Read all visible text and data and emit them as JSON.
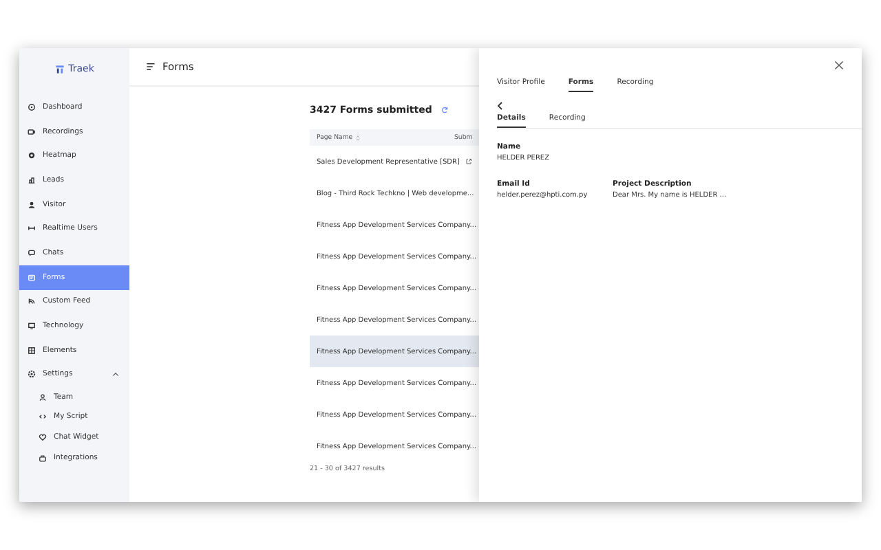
{
  "sidebar": {
    "logo": "Traek",
    "items": [
      {
        "label": "Dashboard",
        "selected": false
      },
      {
        "label": "Recordings",
        "selected": false
      },
      {
        "label": "Heatmap",
        "selected": false
      },
      {
        "label": "Leads",
        "selected": false
      },
      {
        "label": "Visitor",
        "selected": false
      },
      {
        "label": "Realtime Users",
        "selected": false
      },
      {
        "label": "Chats",
        "selected": false
      },
      {
        "label": "Forms",
        "selected": true
      },
      {
        "label": "Custom Feed",
        "selected": false
      },
      {
        "label": "Technology",
        "selected": false
      },
      {
        "label": "Elements",
        "selected": false
      },
      {
        "label": "Settings",
        "selected": false,
        "expanded": true,
        "children": [
          {
            "label": "Team",
            "selected": false
          },
          {
            "label": "My Script",
            "selected": false
          },
          {
            "label": "Chat Widget",
            "selected": false
          },
          {
            "label": "Integrations",
            "selected": false
          }
        ]
      }
    ]
  },
  "header": {
    "title": "Forms"
  },
  "forms": {
    "title": "3427 Forms submitted",
    "columns": [
      "Page Name",
      "Subm"
    ],
    "rows": [
      {
        "page_name": "Sales Development Representative [SDR]",
        "selected": false
      },
      {
        "page_name": "Blog - Third Rock Techkno | Web developme...",
        "selected": false
      },
      {
        "page_name": "Fitness App Development Services Company...",
        "selected": false
      },
      {
        "page_name": "Fitness App Development Services Company...",
        "selected": false
      },
      {
        "page_name": "Fitness App Development Services Company...",
        "selected": false
      },
      {
        "page_name": "Fitness App Development Services Company...",
        "selected": false
      },
      {
        "page_name": "Fitness App Development Services Company...",
        "selected": true
      },
      {
        "page_name": "Fitness App Development Services Company...",
        "selected": false
      },
      {
        "page_name": "Fitness App Development Services Company...",
        "selected": false
      },
      {
        "page_name": "Fitness App Development Services Company...",
        "selected": false
      }
    ],
    "pagination": "21 - 30 of 3427 results"
  },
  "drawer": {
    "tabs": [
      {
        "label": "Visitor Profile",
        "selected": false
      },
      {
        "label": "Forms",
        "selected": true
      },
      {
        "label": "Recording",
        "selected": false
      }
    ],
    "subtabs": [
      {
        "label": "Details",
        "selected": true
      },
      {
        "label": "Recording",
        "selected": false
      }
    ],
    "fields": [
      {
        "label": "Name",
        "value": "HELDER PEREZ"
      },
      {
        "label": "Email Id",
        "value": "helder.perez@hpti.com.py"
      },
      {
        "label": "Project Description",
        "value": "Dear Mrs. My name is HELDER ..."
      }
    ]
  }
}
